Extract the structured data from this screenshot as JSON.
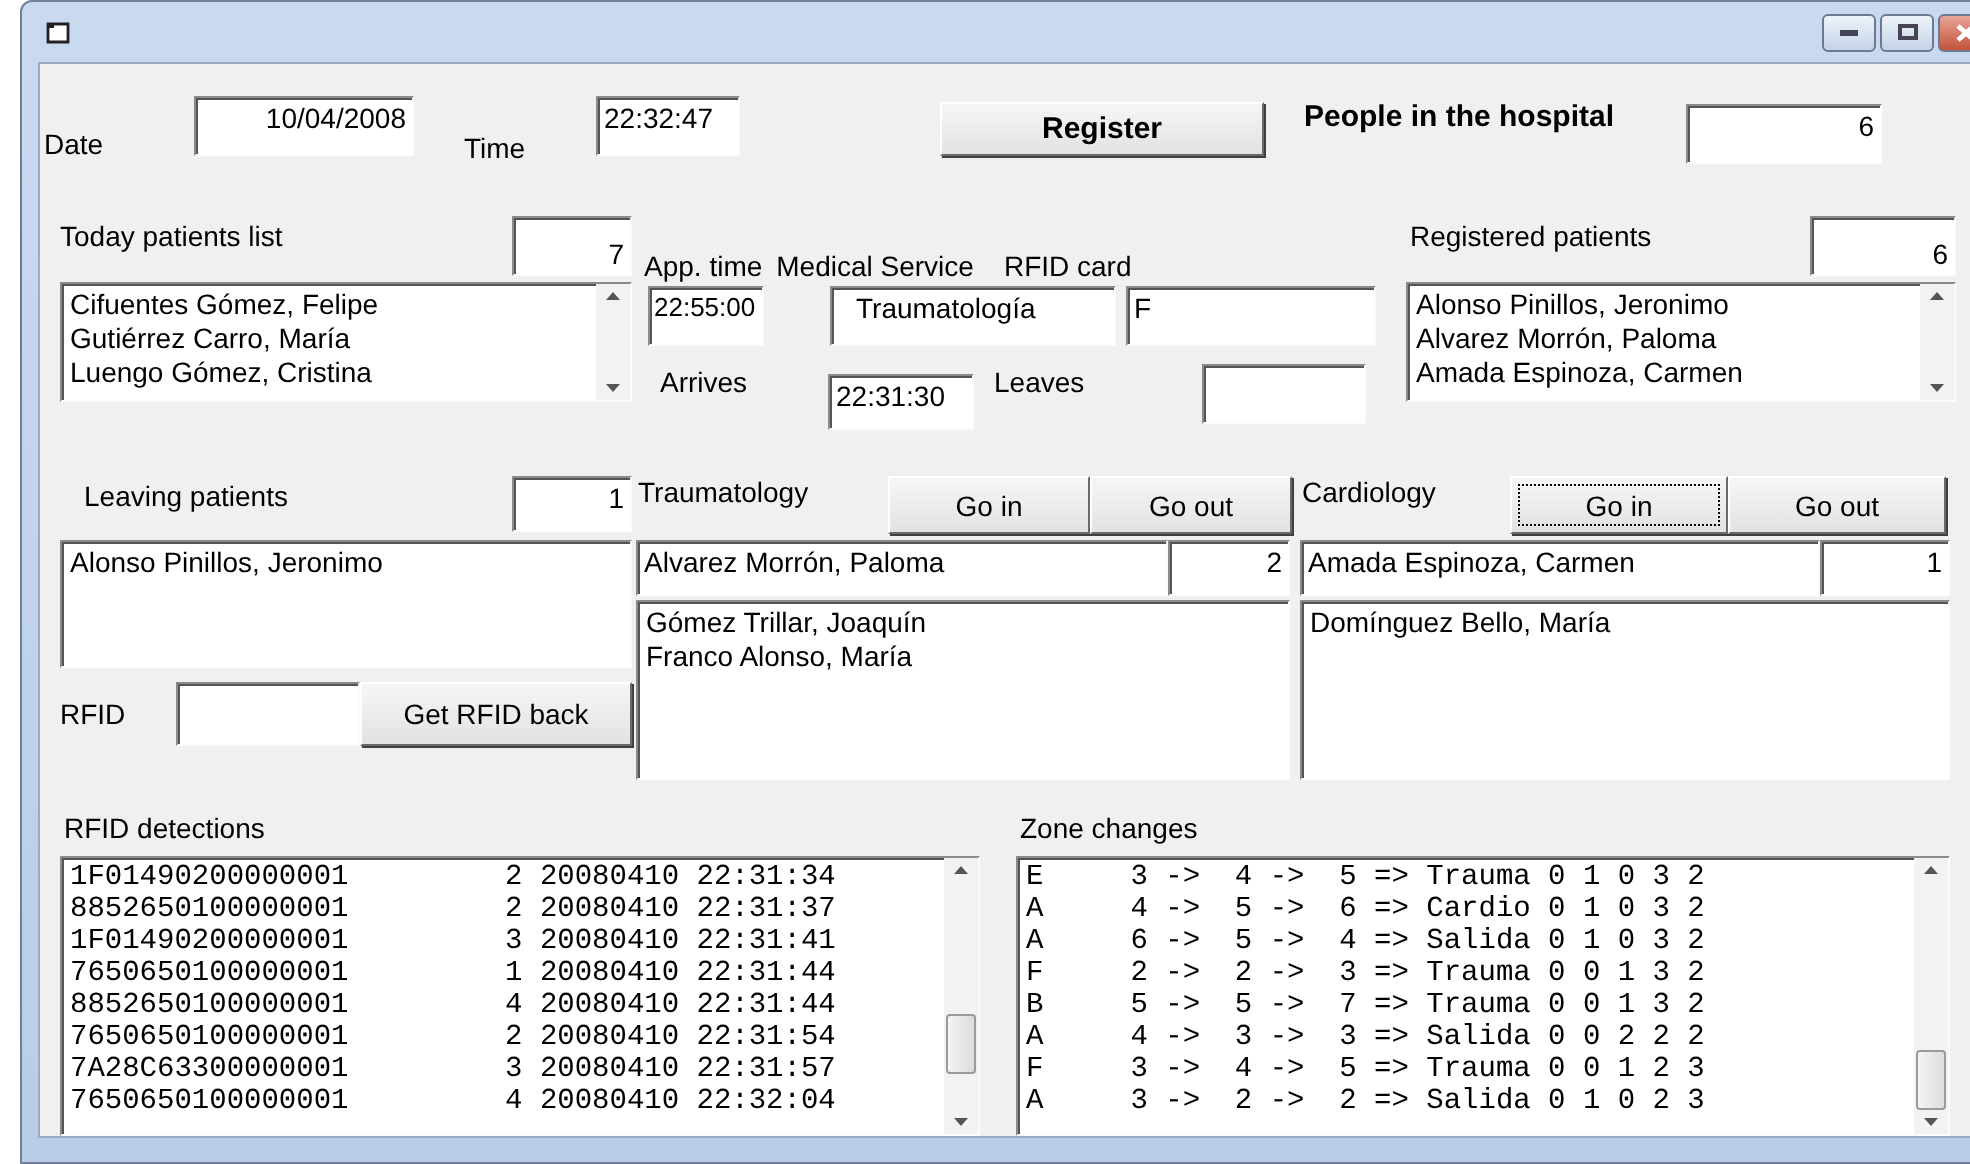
{
  "header": {
    "date_label": "Date",
    "date": "10/04/2008",
    "time_label": "Time",
    "time": "22:32:47",
    "register_button": "Register",
    "people_label": "People in the hospital",
    "people_count": "6"
  },
  "today_patients": {
    "label": "Today patients list",
    "count": "7",
    "items": [
      "Cifuentes Gómez, Felipe",
      "Gutiérrez Carro, María",
      "Luengo Gómez, Cristina"
    ]
  },
  "appointment": {
    "app_time_label": "App. time",
    "app_time": "22:55:00",
    "service_label": "Medical Service",
    "service": "Traumatología",
    "rfid_card_label": "RFID card",
    "rfid_card": "F",
    "arrives_label": "Arrives",
    "arrives": "22:31:30",
    "leaves_label": "Leaves"
  },
  "registered_patients": {
    "label": "Registered patients",
    "count": "6",
    "items": [
      "Alonso Pinillos, Jeronimo",
      "Alvarez Morrón, Paloma",
      "Amada Espinoza, Carmen"
    ]
  },
  "leaving_patients": {
    "label": "Leaving patients",
    "count": "1",
    "items": [
      "Alonso Pinillos, Jeronimo"
    ],
    "rfid_label": "RFID",
    "get_rfid_button": "Get RFID back"
  },
  "services": [
    {
      "name": "Traumatology",
      "buttons": [
        {
          "label": "Go in",
          "focused": false
        },
        {
          "label": "Go out",
          "focused": false
        }
      ],
      "current": "Alvarez Morrón, Paloma",
      "count": "2",
      "queue": [
        "Gómez Trillar, Joaquín",
        "Franco Alonso, María"
      ]
    },
    {
      "name": "Cardiology",
      "buttons": [
        {
          "label": "Go in",
          "focused": true
        },
        {
          "label": "Go out",
          "focused": false
        }
      ],
      "current": "Amada Espinoza, Carmen",
      "count": "1",
      "queue": [
        "Domínguez Bello, María"
      ]
    }
  ],
  "rfid_detections": {
    "label": "RFID detections",
    "rows": [
      "1F01490200000001         2 20080410 22:31:34",
      "8852650100000001         2 20080410 22:31:37",
      "1F01490200000001         3 20080410 22:31:41",
      "7650650100000001         1 20080410 22:31:44",
      "8852650100000001         4 20080410 22:31:44",
      "7650650100000001         2 20080410 22:31:54",
      "7A28C63300000001         3 20080410 22:31:57",
      "7650650100000001         4 20080410 22:32:04"
    ]
  },
  "zone_changes": {
    "label": "Zone changes",
    "rows": [
      "E     3 ->  4 ->  5 => Trauma 0 1 0 3 2",
      "A     4 ->  5 ->  6 => Cardio 0 1 0 3 2",
      "A     6 ->  5 ->  4 => Salida 0 1 0 3 2",
      "F     2 ->  2 ->  3 => Trauma 0 0 1 3 2",
      "B     5 ->  5 ->  7 => Trauma 0 0 1 3 2",
      "A     4 ->  3 ->  3 => Salida 0 0 2 2 2",
      "F     3 ->  4 ->  5 => Trauma 0 0 1 2 3",
      "A     3 ->  2 ->  2 => Salida 0 1 0 2 3"
    ]
  }
}
